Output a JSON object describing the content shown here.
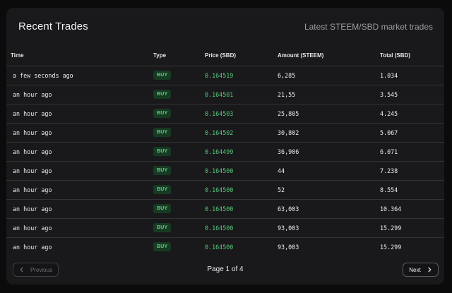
{
  "header": {
    "title": "Recent Trades",
    "subtitle": "Latest STEEM/SBD market trades"
  },
  "table": {
    "columns": [
      "Time",
      "Type",
      "Price (SBD)",
      "Amount (STEEM)",
      "Total (SBD)"
    ],
    "rows": [
      {
        "time": "a few seconds ago",
        "type": "BUY",
        "price": "0.164519",
        "amount": "6,285",
        "total": "1.034"
      },
      {
        "time": "an hour ago",
        "type": "BUY",
        "price": "0.164501",
        "amount": "21,55",
        "total": "3.545"
      },
      {
        "time": "an hour ago",
        "type": "BUY",
        "price": "0.164503",
        "amount": "25,805",
        "total": "4.245"
      },
      {
        "time": "an hour ago",
        "type": "BUY",
        "price": "0.164502",
        "amount": "30,802",
        "total": "5.067"
      },
      {
        "time": "an hour ago",
        "type": "BUY",
        "price": "0.164499",
        "amount": "36,906",
        "total": "6.071"
      },
      {
        "time": "an hour ago",
        "type": "BUY",
        "price": "0.164500",
        "amount": "44",
        "total": "7.238"
      },
      {
        "time": "an hour ago",
        "type": "BUY",
        "price": "0.164500",
        "amount": "52",
        "total": "8.554"
      },
      {
        "time": "an hour ago",
        "type": "BUY",
        "price": "0.164500",
        "amount": "63,003",
        "total": "10.364"
      },
      {
        "time": "an hour ago",
        "type": "BUY",
        "price": "0.164500",
        "amount": "93,003",
        "total": "15.299"
      },
      {
        "time": "an hour ago",
        "type": "BUY",
        "price": "0.164500",
        "amount": "93,003",
        "total": "15.299"
      }
    ]
  },
  "pagination": {
    "previous_label": "Previous",
    "next_label": "Next",
    "page_info": "Page 1 of 4",
    "previous_icon": "chevron-left-icon",
    "next_icon": "chevron-right-icon"
  },
  "colors": {
    "background": "#0b0b0c",
    "card": "#19191b",
    "buy_badge_bg": "#173a23",
    "buy_text": "#5fd184",
    "price_text": "#56c97a"
  }
}
